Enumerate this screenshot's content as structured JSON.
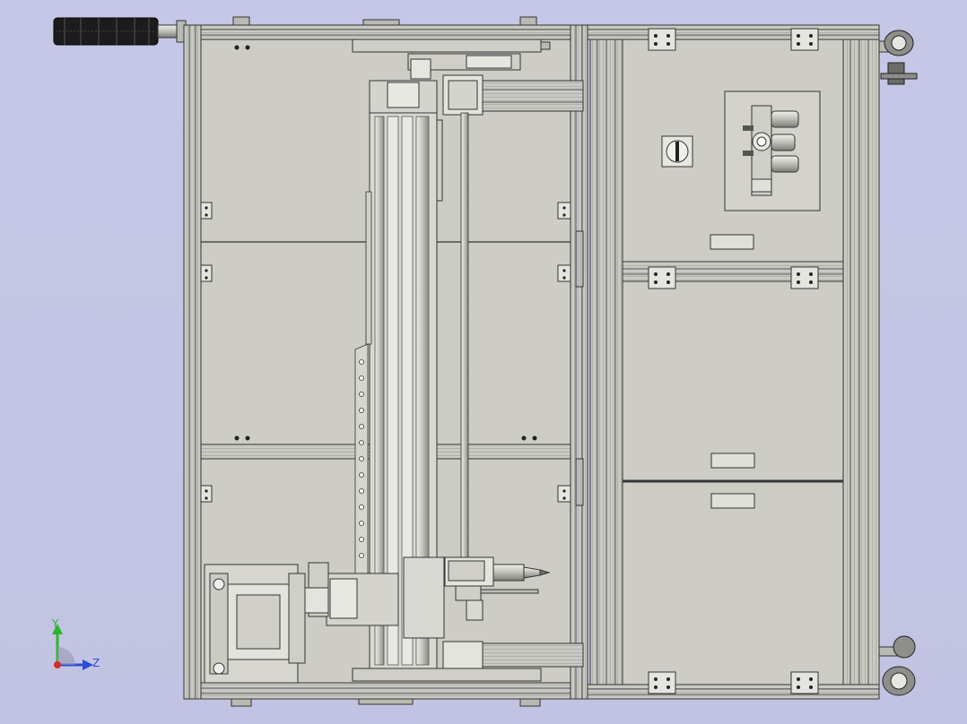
{
  "viewport": {
    "background": "#c4c5e4",
    "frame_color": "#b9bab3",
    "panel_color": "#cdcdc6",
    "line_color": "#3a3a3a",
    "dark_part_color": "#1c1c1c"
  },
  "triad": {
    "y_label": "Y",
    "z_label": "Z",
    "y_color": "#2cb52c",
    "z_color": "#2b4fd6",
    "x_color": "#d62b2b"
  }
}
